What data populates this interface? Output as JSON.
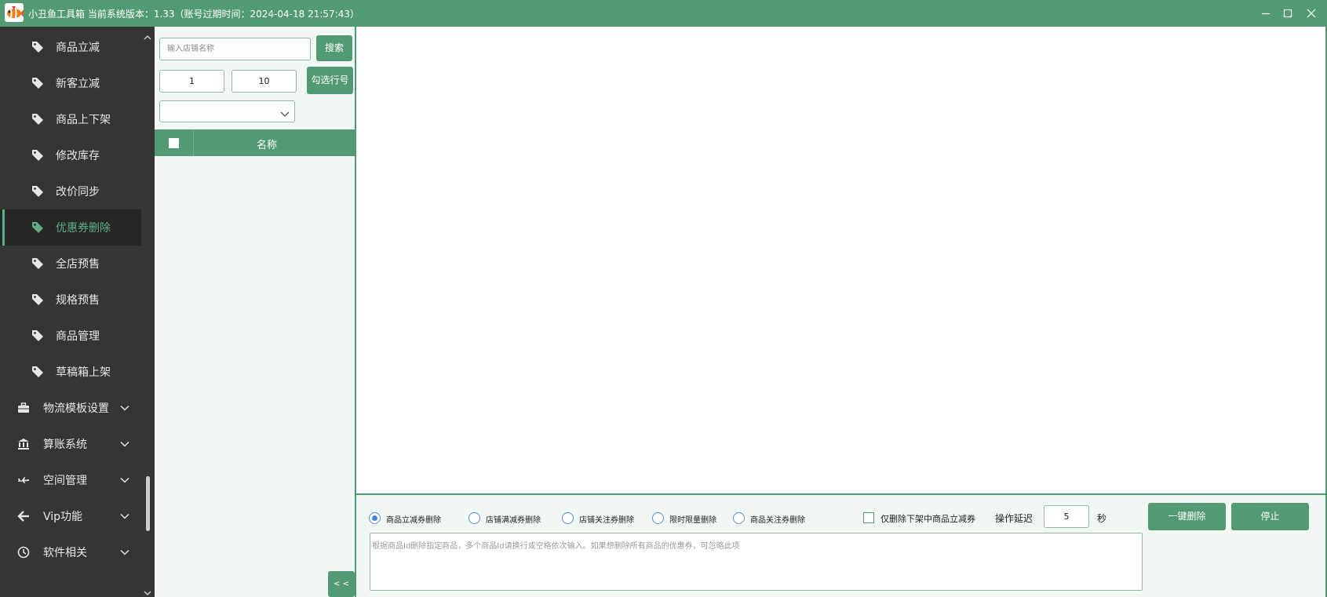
{
  "window": {
    "title": "小丑鱼工具箱 当前系统版本：1.33（账号过期时间：2024-04-18 21:57:43）",
    "logo_icon": "clownfish-logo",
    "controls": [
      "minimize-icon",
      "maximize-icon",
      "close-icon"
    ]
  },
  "sidebar": {
    "items": [
      {
        "label": "商品立减",
        "icon": "tag-icon",
        "active": false
      },
      {
        "label": "新客立减",
        "icon": "tag-icon",
        "active": false
      },
      {
        "label": "商品上下架",
        "icon": "tag-icon",
        "active": false
      },
      {
        "label": "修改库存",
        "icon": "tag-icon",
        "active": false
      },
      {
        "label": "改价同步",
        "icon": "tag-icon",
        "active": false
      },
      {
        "label": "优惠券删除",
        "icon": "tag-icon",
        "active": true
      },
      {
        "label": "全店预售",
        "icon": "tag-icon",
        "active": false
      },
      {
        "label": "规格预售",
        "icon": "tag-icon",
        "active": false
      },
      {
        "label": "商品管理",
        "icon": "tag-icon",
        "active": false
      },
      {
        "label": "草稿箱上架",
        "icon": "tag-icon",
        "active": false
      }
    ],
    "groups": [
      {
        "label": "物流模板设置",
        "icon": "briefcase-icon"
      },
      {
        "label": "算账系统",
        "icon": "bank-icon"
      },
      {
        "label": "空间管理",
        "icon": "plane-icon"
      },
      {
        "label": "Vip功能",
        "icon": "arrow-left-icon"
      },
      {
        "label": "软件相关",
        "icon": "clock-icon"
      }
    ],
    "accent": "#5fae84"
  },
  "shop_panel": {
    "search_placeholder": "输入店铺名称",
    "search_label": "搜索",
    "page_from": "1",
    "page_size": "10",
    "select_rows_label": "勾选行号",
    "dropdown_value": "",
    "table": {
      "columns": [
        "名称"
      ],
      "rows": []
    },
    "collapse_label": "< <"
  },
  "bottom": {
    "options": [
      {
        "label": "商品立减券删除",
        "checked": true
      },
      {
        "label": "店铺满减券删除",
        "checked": false
      },
      {
        "label": "店铺关注券删除",
        "checked": false
      },
      {
        "label": "限时限量删除",
        "checked": false
      },
      {
        "label": "商品关注券删除",
        "checked": false
      }
    ],
    "only_offshelf_label": "仅删除下架中商品立减券",
    "only_offshelf_checked": false,
    "delay_label": "操作延迟",
    "delay_value": "5",
    "delay_unit": "秒",
    "delete_label": "一键删除",
    "stop_label": "停止",
    "ids_placeholder": "根据商品Id删除指定商品，多个商品Id请换行或空格依次输入。如果想删除所有商品的优惠券，可忽略此项"
  },
  "colors": {
    "primary": "#529a73",
    "sidebar_bg": "#353535",
    "panel_bg": "#f1f7f3"
  }
}
